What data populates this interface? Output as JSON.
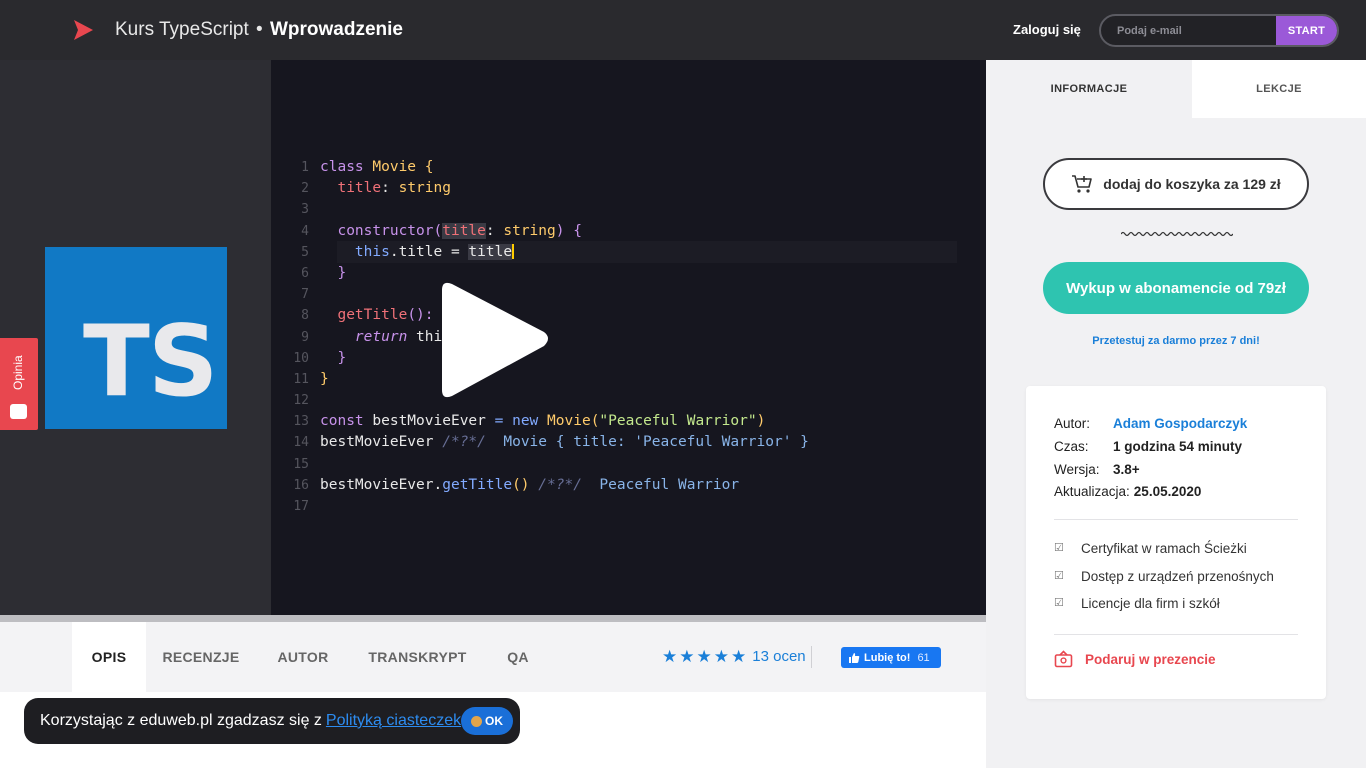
{
  "header": {
    "course_prefix": "Kurs TypeScript",
    "separator": "•",
    "course_section": "Wprowadzenie",
    "login_label": "Zaloguj się",
    "email_placeholder": "Podaj e-mail",
    "start_label": "START",
    "brand_color": "#e8474f",
    "accent_color": "#9b59d8"
  },
  "video": {
    "ts_logo_text": "TS",
    "feedback_label": "Opinia",
    "code_lines": [
      {
        "n": "1"
      },
      {
        "n": "2"
      },
      {
        "n": "3"
      },
      {
        "n": "4"
      },
      {
        "n": "5"
      },
      {
        "n": "6"
      },
      {
        "n": "7"
      },
      {
        "n": "8"
      },
      {
        "n": "9"
      },
      {
        "n": "10"
      },
      {
        "n": "11"
      },
      {
        "n": "12"
      },
      {
        "n": "13"
      },
      {
        "n": "14"
      },
      {
        "n": "15"
      },
      {
        "n": "16"
      },
      {
        "n": "17"
      }
    ],
    "code": {
      "l1_kw": "class",
      "l1_name": "Movie",
      "l1_brace": "{",
      "l2_prop": "title",
      "l2_colon": ":",
      "l2_type": "string",
      "l4_fn": "constructor",
      "l4_open": "(",
      "l4_param": "title",
      "l4_colon": ":",
      "l4_type": "string",
      "l4_close": ")",
      "l4_brace": "{",
      "l5_this": "this",
      "l5_rest": ".title = ",
      "l5_val": "title",
      "l6_brace": "}",
      "l8_fn": "getTitle",
      "l8_paren": "():",
      "l9_ret": "return",
      "l9_rest": "this.title",
      "l10_brace": "}",
      "l11_brace": "}",
      "l13_kw": "const",
      "l13_var": "bestMovieEver",
      "l13_eq": "=",
      "l13_new": "new",
      "l13_cls": "Movie",
      "l13_open": "(",
      "l13_str": "\"Peaceful Warrior\"",
      "l13_close": ")",
      "l14_var": "bestMovieEver",
      "l14_cm": "/*?*/",
      "l14_res": "Movie { title: 'Peaceful Warrior' }",
      "l16_var": "bestMovieEver",
      "l16_dot": ".",
      "l16_fn": "getTitle",
      "l16_paren": "()",
      "l16_cm": "/*?*/",
      "l16_res": "Peaceful Warrior"
    }
  },
  "tabs": [
    {
      "label": "OPIS",
      "active": true
    },
    {
      "label": "RECENZJE"
    },
    {
      "label": "AUTOR"
    },
    {
      "label": "TRANSKRYPT"
    },
    {
      "label": "QA"
    }
  ],
  "rating": {
    "stars": 5,
    "count_label": "13 ocen"
  },
  "like": {
    "label": "Lubię to!",
    "count": "61"
  },
  "cookie": {
    "text": "Korzystając z eduweb.pl zgadzasz się z",
    "link": "Polityką ciasteczek",
    "ok": "OK"
  },
  "sidebar": {
    "tabs": [
      {
        "label": "INFORMACJE",
        "active": true
      },
      {
        "label": "LEKCJE"
      }
    ],
    "cart_label": "dodaj do koszyka za 129 zł",
    "subscription_label": "Wykup w abonamencie od 79zł",
    "trial_label": "Przetestuj za darmo przez 7 dni!",
    "meta": [
      {
        "key": "Autor:",
        "value": "Adam Gospodarczyk"
      },
      {
        "key": "Czas:",
        "value": "1 godzina 54 minuty"
      },
      {
        "key": "Wersja:",
        "value": "3.8+"
      },
      {
        "key": "Aktualizacja:",
        "value": "25.05.2020"
      }
    ],
    "features": [
      "Certyfikat w ramach Ścieżki",
      "Dostęp z urządzeń przenośnych",
      "Licencje dla firm i szkół"
    ],
    "gift_label": "Podaruj w prezencie",
    "teal_color": "#2ec4b0",
    "link_color": "#1a7fd8"
  }
}
